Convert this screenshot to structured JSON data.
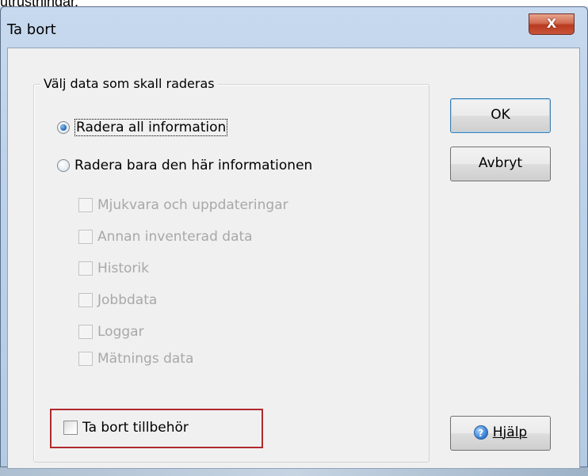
{
  "background": {
    "cut_text": "utrustningar."
  },
  "dialog": {
    "title": "Ta bort",
    "close_glyph": "X"
  },
  "group": {
    "legend": "Välj data som skall raderas",
    "radio_all": {
      "label": "Radera all information",
      "checked": true
    },
    "radio_partial": {
      "label": "Radera bara den här informationen",
      "checked": false
    },
    "options": [
      {
        "label": "Mjukvara och uppdateringar",
        "checked": false,
        "enabled": false
      },
      {
        "label": "Annan inventerad data",
        "checked": false,
        "enabled": false
      },
      {
        "label": "Historik",
        "checked": false,
        "enabled": false
      },
      {
        "label": "Jobbdata",
        "checked": false,
        "enabled": false
      },
      {
        "label": "Loggar",
        "checked": false,
        "enabled": false
      },
      {
        "label": "Mätnings data",
        "checked": false,
        "enabled": false
      }
    ],
    "remove_accessories": {
      "label": "Ta bort tillbehör",
      "checked": false
    }
  },
  "buttons": {
    "ok": "OK",
    "cancel": "Avbryt",
    "help": "Hjälp",
    "help_icon_glyph": "?"
  },
  "colors": {
    "highlight": "#b0292e",
    "close_button": "#c9553a",
    "radio_selected": "#2a6fb9"
  }
}
